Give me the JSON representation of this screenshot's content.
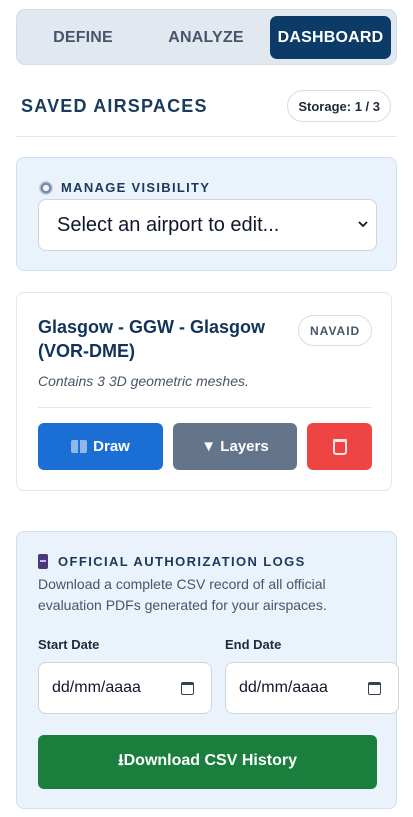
{
  "tabs": [
    {
      "label": "DEFINE",
      "active": false
    },
    {
      "label": "ANALYZE",
      "active": false
    },
    {
      "label": "DASHBOARD",
      "active": true
    }
  ],
  "saved": {
    "title": "SAVED AIRSPACES",
    "storage": "Storage: 1 / 3"
  },
  "visibility": {
    "label": "MANAGE VISIBILITY",
    "icon": "gear-icon",
    "select_value": "Select an airport to edit..."
  },
  "airspace": {
    "name": "Glasgow - GGW - Glasgow (VOR-DME)",
    "badge": "NAVAID",
    "description": "Contains 3 3D geometric meshes.",
    "draw_label": "Draw",
    "layers_label": "▼ Layers",
    "draw_icon": "map-icon",
    "delete_icon": "trash-icon"
  },
  "logs": {
    "title": "OFFICIAL AUTHORIZATION LOGS",
    "icon": "file-cabinet-icon",
    "description": "Download a complete CSV record of all official evaluation PDFs generated for your airspaces.",
    "start_label": "Start Date",
    "end_label": "End Date",
    "start_value": "dd/mm/aaaa",
    "end_value": "dd/mm/aaaa",
    "download_label": "⭳Download CSV History"
  },
  "colors": {
    "accent": "#0c3b67",
    "draw": "#1b6fd4",
    "layers": "#64748b",
    "delete": "#ef4444",
    "download": "#1a7f3c",
    "panel": "#eaf2fc"
  }
}
